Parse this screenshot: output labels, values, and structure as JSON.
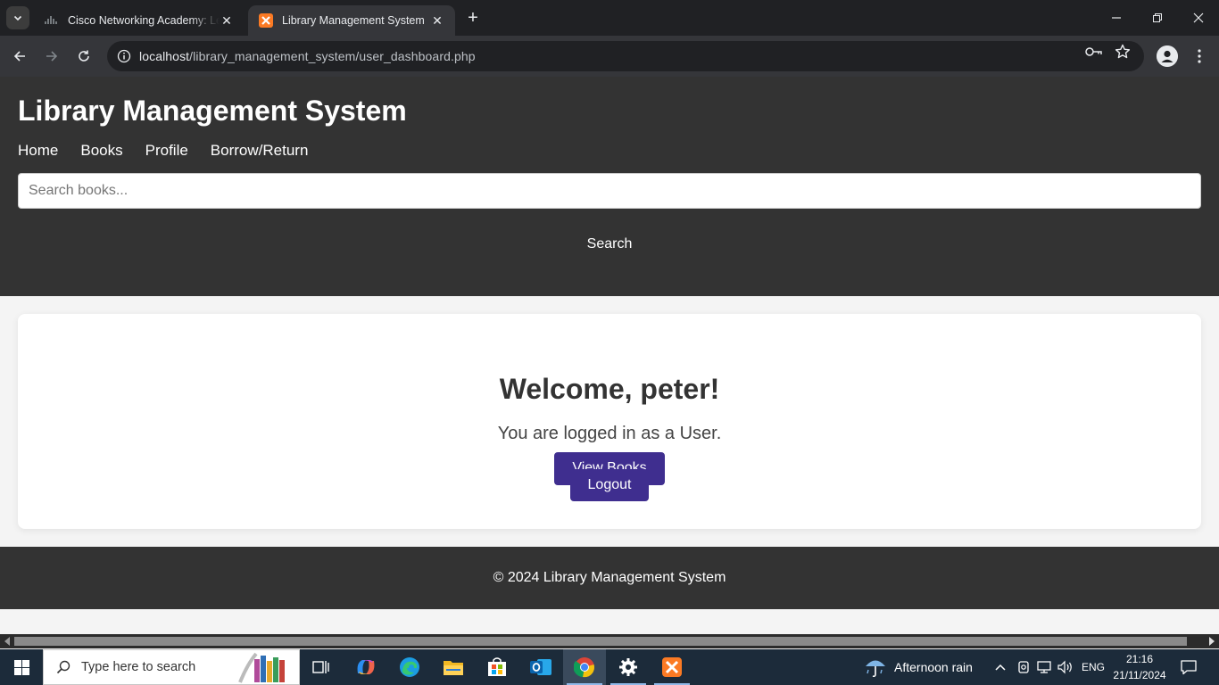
{
  "browser": {
    "tabs": [
      {
        "title": "Cisco Networking Academy: Learn",
        "active": false
      },
      {
        "title": "Library Management System",
        "active": true
      }
    ],
    "url_host": "localhost",
    "url_path": "/library_management_system/user_dashboard.php"
  },
  "site": {
    "title": "Library Management System",
    "nav": [
      "Home",
      "Books",
      "Profile",
      "Borrow/Return"
    ],
    "search_placeholder": "Search books...",
    "search_button": "Search"
  },
  "dashboard": {
    "welcome": "Welcome, peter!",
    "role_text": "You are logged in as a User.",
    "view_books_button": "View Books",
    "logout_button": "Logout"
  },
  "footer": {
    "text": "© 2024 Library Management System"
  },
  "taskbar": {
    "search_placeholder": "Type here to search",
    "weather": "Afternoon rain",
    "language": "ENG",
    "time": "21:16",
    "date": "21/11/2024"
  },
  "colors": {
    "header_bg": "#333333",
    "button_accent": "#3f2e8f",
    "page_bg": "#f4f4f4"
  }
}
